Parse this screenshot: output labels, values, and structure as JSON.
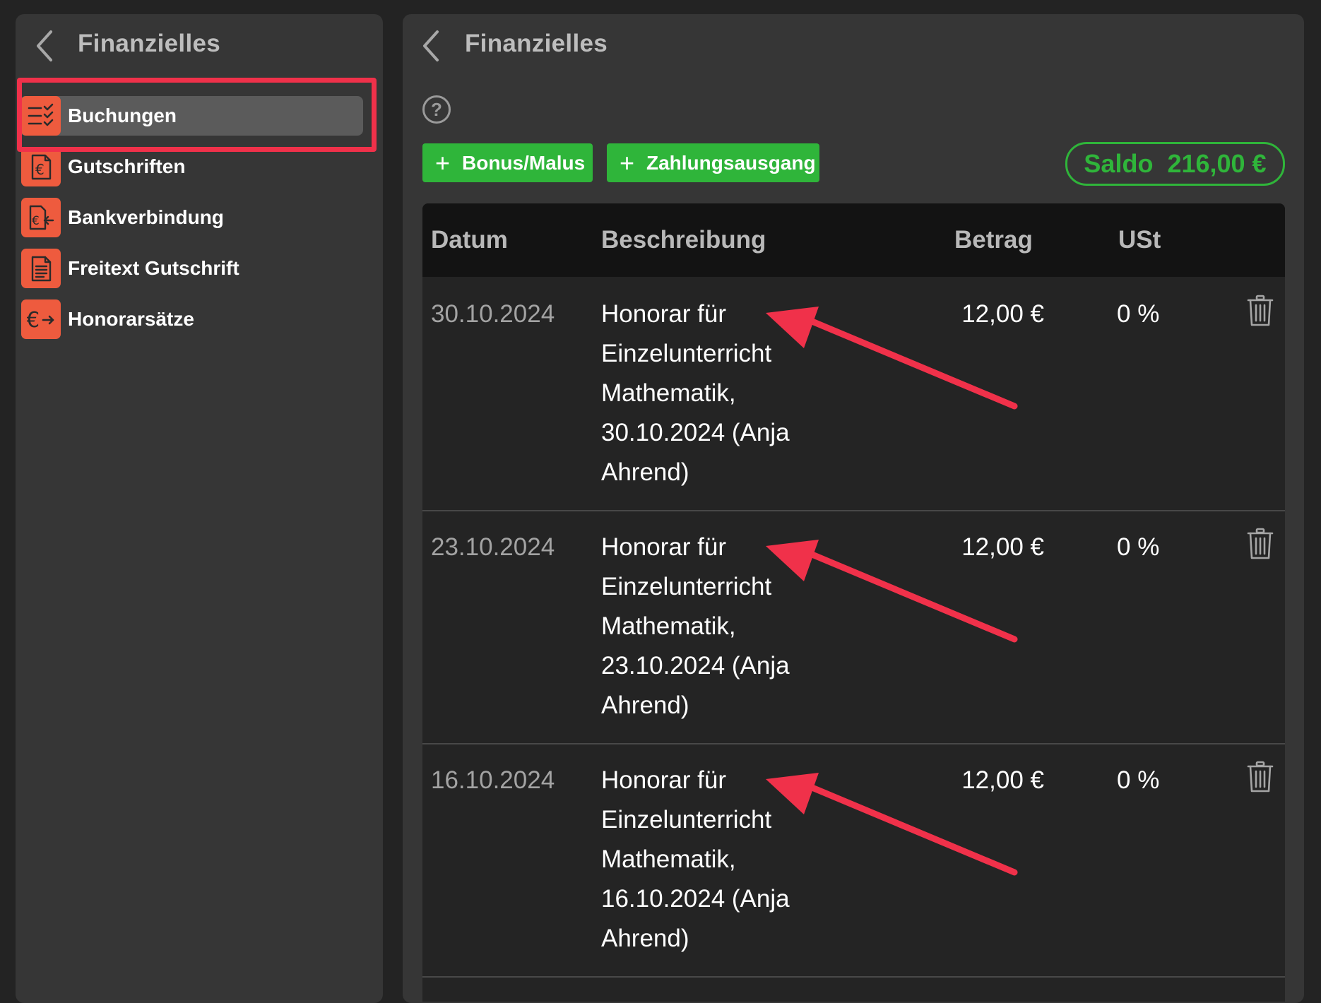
{
  "sidebar": {
    "title": "Finanzielles",
    "items": [
      {
        "label": "Buchungen",
        "icon": "list-check-icon",
        "selected": true
      },
      {
        "label": "Gutschriften",
        "icon": "euro-document-icon",
        "selected": false
      },
      {
        "label": "Bankverbindung",
        "icon": "euro-transfer-in-icon",
        "selected": false
      },
      {
        "label": "Freitext Gutschrift",
        "icon": "text-document-icon",
        "selected": false
      },
      {
        "label": "Honorarsätze",
        "icon": "euro-arrow-icon",
        "selected": false
      }
    ]
  },
  "main": {
    "title": "Finanzielles",
    "help_icon": "question-circle-icon",
    "buttons": {
      "bonus_malus": {
        "plus": "+",
        "label": "Bonus/Malus"
      },
      "payment_out": {
        "plus": "+",
        "label": "Zahlungsausgang"
      }
    },
    "balance": {
      "label": "Saldo",
      "value": "216,00 €"
    },
    "table": {
      "headers": {
        "date": "Datum",
        "description": "Beschreibung",
        "amount": "Betrag",
        "vat": "USt"
      },
      "rows": [
        {
          "date": "30.10.2024",
          "description": "Honorar für Einzelunterricht Mathematik, 30.10.2024 (Anja Ahrend)",
          "amount": "12,00 €",
          "vat": "0 %"
        },
        {
          "date": "23.10.2024",
          "description": "Honorar für Einzelunterricht Mathematik, 23.10.2024 (Anja Ahrend)",
          "amount": "12,00 €",
          "vat": "0 %"
        },
        {
          "date": "16.10.2024",
          "description": "Honorar für Einzelunterricht Mathematik, 16.10.2024 (Anja Ahrend)",
          "amount": "12,00 €",
          "vat": "0 %"
        }
      ]
    }
  },
  "colors": {
    "accent_orange": "#ee5b3e",
    "green": "#2fb53a",
    "annotation_red": "#f0314a"
  }
}
